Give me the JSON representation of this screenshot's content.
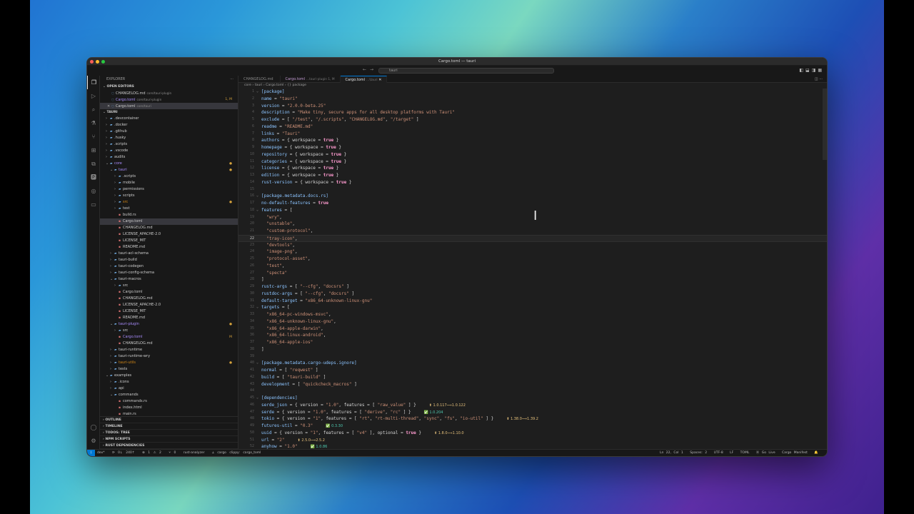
{
  "window": {
    "title": "Cargo.toml — tauri"
  },
  "command_center": {
    "text": "tauri"
  },
  "colors": {
    "accent": "#0078d4",
    "modified": "#e2c08d"
  },
  "activity_bar": [
    "files-icon",
    "run-debug-icon",
    "search-icon",
    "testing-icon",
    "source-control-icon",
    "extensions-icon",
    "remote-explorer-icon",
    "docker-icon",
    "github-icon",
    "chat-icon"
  ],
  "sidebar": {
    "title": "EXPLORER",
    "open_editors_label": "OPEN EDITORS",
    "open_editors": [
      {
        "prefix": "",
        "name": "CHANGELOG.md",
        "path": "core/tauri-plugin",
        "badge": ""
      },
      {
        "prefix": "",
        "name": "Cargo.toml",
        "path": "core/tauri-plugin",
        "badge": "1, M"
      },
      {
        "prefix": "✕",
        "name": "Cargo.toml",
        "path": "core/tauri",
        "badge": ""
      }
    ],
    "project_label": "TAURI",
    "tree": [
      {
        "name": ".devcontainer",
        "depth": 1,
        "kind": "folder",
        "state": "",
        "badge": ""
      },
      {
        "name": ".docker",
        "depth": 1,
        "kind": "folder",
        "state": "",
        "badge": ""
      },
      {
        "name": ".github",
        "depth": 1,
        "kind": "folder",
        "state": "",
        "badge": ""
      },
      {
        "name": ".husky",
        "depth": 1,
        "kind": "folder",
        "state": "",
        "badge": ""
      },
      {
        "name": ".scripts",
        "depth": 1,
        "kind": "folder",
        "state": "",
        "badge": ""
      },
      {
        "name": ".vscode",
        "depth": 1,
        "kind": "folder",
        "state": "",
        "badge": ""
      },
      {
        "name": "audits",
        "depth": 1,
        "kind": "folder",
        "state": "",
        "badge": ""
      },
      {
        "name": "core",
        "depth": 1,
        "kind": "folder-open",
        "state": "pur",
        "badge": "●"
      },
      {
        "name": "tauri",
        "depth": 2,
        "kind": "folder-open",
        "state": "pur",
        "badge": "●"
      },
      {
        "name": ".scripts",
        "depth": 3,
        "kind": "folder",
        "state": "",
        "badge": ""
      },
      {
        "name": "mobile",
        "depth": 3,
        "kind": "folder",
        "state": "",
        "badge": ""
      },
      {
        "name": "permissions",
        "depth": 3,
        "kind": "folder",
        "state": "",
        "badge": ""
      },
      {
        "name": "scripts",
        "depth": 3,
        "kind": "folder",
        "state": "",
        "badge": ""
      },
      {
        "name": "src",
        "depth": 3,
        "kind": "folder",
        "state": "orange",
        "badge": "●"
      },
      {
        "name": "test",
        "depth": 3,
        "kind": "folder",
        "state": "",
        "badge": ""
      },
      {
        "name": "build.rs",
        "depth": 3,
        "kind": "file",
        "state": "",
        "badge": ""
      },
      {
        "name": "Cargo.toml",
        "depth": 3,
        "kind": "file",
        "state": "sel",
        "badge": ""
      },
      {
        "name": "CHANGELOG.md",
        "depth": 3,
        "kind": "file",
        "state": "",
        "badge": ""
      },
      {
        "name": "LICENSE_APACHE-2.0",
        "depth": 3,
        "kind": "file",
        "state": "",
        "badge": ""
      },
      {
        "name": "LICENSE_MIT",
        "depth": 3,
        "kind": "file",
        "state": "",
        "badge": ""
      },
      {
        "name": "README.md",
        "depth": 3,
        "kind": "file",
        "state": "",
        "badge": ""
      },
      {
        "name": "tauri-acl-schema",
        "depth": 2,
        "kind": "folder",
        "state": "",
        "badge": ""
      },
      {
        "name": "tauri-build",
        "depth": 2,
        "kind": "folder",
        "state": "",
        "badge": ""
      },
      {
        "name": "tauri-codegen",
        "depth": 2,
        "kind": "folder",
        "state": "",
        "badge": ""
      },
      {
        "name": "tauri-config-schema",
        "depth": 2,
        "kind": "folder",
        "state": "",
        "badge": ""
      },
      {
        "name": "tauri-macros",
        "depth": 2,
        "kind": "folder-open",
        "state": "",
        "badge": ""
      },
      {
        "name": "src",
        "depth": 3,
        "kind": "folder",
        "state": "",
        "badge": ""
      },
      {
        "name": "Cargo.toml",
        "depth": 3,
        "kind": "file",
        "state": "",
        "badge": ""
      },
      {
        "name": "CHANGELOG.md",
        "depth": 3,
        "kind": "file",
        "state": "",
        "badge": ""
      },
      {
        "name": "LICENSE_APACHE-2.0",
        "depth": 3,
        "kind": "file",
        "state": "",
        "badge": ""
      },
      {
        "name": "LICENSE_MIT",
        "depth": 3,
        "kind": "file",
        "state": "",
        "badge": ""
      },
      {
        "name": "README.md",
        "depth": 3,
        "kind": "file",
        "state": "",
        "badge": ""
      },
      {
        "name": "tauri-plugin",
        "depth": 2,
        "kind": "folder-open",
        "state": "pur",
        "badge": "●"
      },
      {
        "name": "src",
        "depth": 3,
        "kind": "folder",
        "state": "",
        "badge": ""
      },
      {
        "name": "Cargo.toml",
        "depth": 3,
        "kind": "file",
        "state": "pur",
        "badge": "M"
      },
      {
        "name": "CHANGELOG.md",
        "depth": 3,
        "kind": "file",
        "state": "",
        "badge": ""
      },
      {
        "name": "tauri-runtime",
        "depth": 2,
        "kind": "folder",
        "state": "",
        "badge": ""
      },
      {
        "name": "tauri-runtime-wry",
        "depth": 2,
        "kind": "folder",
        "state": "",
        "badge": ""
      },
      {
        "name": "tauri-utils",
        "depth": 2,
        "kind": "folder",
        "state": "orange",
        "badge": "●"
      },
      {
        "name": "tests",
        "depth": 2,
        "kind": "folder",
        "state": "",
        "badge": ""
      },
      {
        "name": "examples",
        "depth": 1,
        "kind": "folder-open",
        "state": "",
        "badge": ""
      },
      {
        "name": ".icons",
        "depth": 2,
        "kind": "folder",
        "state": "",
        "badge": ""
      },
      {
        "name": "api",
        "depth": 2,
        "kind": "folder",
        "state": "",
        "badge": ""
      },
      {
        "name": "commands",
        "depth": 2,
        "kind": "folder-open",
        "state": "",
        "badge": ""
      },
      {
        "name": "commands.rs",
        "depth": 3,
        "kind": "file",
        "state": "",
        "badge": ""
      },
      {
        "name": "index.html",
        "depth": 3,
        "kind": "file",
        "state": "",
        "badge": ""
      },
      {
        "name": "main.rs",
        "depth": 3,
        "kind": "file",
        "state": "",
        "badge": ""
      }
    ],
    "bottom_sections": [
      "OUTLINE",
      "TIMELINE",
      "TODOS: TREE",
      "NPM SCRIPTS",
      "RUST DEPENDENCIES"
    ]
  },
  "tabs": [
    {
      "label": "CHANGELOG.md",
      "sub": "",
      "active": false,
      "modified": false
    },
    {
      "label": "Cargo.toml",
      "sub": "...tauri-plugin 1, M",
      "active": false,
      "modified": true
    },
    {
      "label": "Cargo.toml",
      "sub": "...\\tauri",
      "active": true,
      "modified": false
    }
  ],
  "breadcrumb": "core › tauri › Cargo.toml › {} package",
  "code": [
    {
      "n": "1",
      "f": "⌄",
      "t": "[package]"
    },
    {
      "n": "2",
      "f": "",
      "t": "name = \"tauri\""
    },
    {
      "n": "3",
      "f": "",
      "t": "version = \"2.0.0-beta.25\""
    },
    {
      "n": "4",
      "f": "",
      "t": "description = \"Make tiny, secure apps for all desktop platforms with Tauri\""
    },
    {
      "n": "5",
      "f": "",
      "t": "exclude = [ \"/test\", \"/.scripts\", \"CHANGELOG.md\", \"/target\" ]"
    },
    {
      "n": "6",
      "f": "",
      "t": "readme = \"README.md\""
    },
    {
      "n": "7",
      "f": "",
      "t": "links = \"Tauri\""
    },
    {
      "n": "8",
      "f": "",
      "t": "authors = { workspace = true }"
    },
    {
      "n": "9",
      "f": "",
      "t": "homepage = { workspace = true }"
    },
    {
      "n": "10",
      "f": "",
      "t": "repository = { workspace = true }"
    },
    {
      "n": "11",
      "f": "",
      "t": "categories = { workspace = true }"
    },
    {
      "n": "12",
      "f": "",
      "t": "license = { workspace = true }"
    },
    {
      "n": "13",
      "f": "",
      "t": "edition = { workspace = true }"
    },
    {
      "n": "14",
      "f": "",
      "t": "rust-version = { workspace = true }"
    },
    {
      "n": "15",
      "f": "",
      "t": ""
    },
    {
      "n": "16",
      "f": "⌄",
      "t": "[package.metadata.docs.rs]"
    },
    {
      "n": "17",
      "f": "",
      "t": "no-default-features = true"
    },
    {
      "n": "18",
      "f": "⌄",
      "t": "features = ["
    },
    {
      "n": "19",
      "f": "",
      "t": "  \"wry\","
    },
    {
      "n": "20",
      "f": "",
      "t": "  \"unstable\","
    },
    {
      "n": "21",
      "f": "",
      "t": "  \"custom-protocol\","
    },
    {
      "n": "22",
      "f": "",
      "t": "  \"tray-icon\",",
      "cur": true
    },
    {
      "n": "23",
      "f": "",
      "t": "  \"devtools\","
    },
    {
      "n": "24",
      "f": "",
      "t": "  \"image-png\","
    },
    {
      "n": "25",
      "f": "",
      "t": "  \"protocol-asset\","
    },
    {
      "n": "26",
      "f": "",
      "t": "  \"test\","
    },
    {
      "n": "27",
      "f": "",
      "t": "  \"specta\""
    },
    {
      "n": "28",
      "f": "",
      "t": "]"
    },
    {
      "n": "29",
      "f": "",
      "t": "rustc-args = [ \"--cfg\", \"docsrs\" ]"
    },
    {
      "n": "30",
      "f": "",
      "t": "rustdoc-args = [ \"--cfg\", \"docsrs\" ]"
    },
    {
      "n": "31",
      "f": "",
      "t": "default-target = \"x86_64-unknown-linux-gnu\""
    },
    {
      "n": "32",
      "f": "⌄",
      "t": "targets = ["
    },
    {
      "n": "33",
      "f": "",
      "t": "  \"x86_64-pc-windows-msvc\","
    },
    {
      "n": "34",
      "f": "",
      "t": "  \"x86_64-unknown-linux-gnu\","
    },
    {
      "n": "35",
      "f": "",
      "t": "  \"x86_64-apple-darwin\","
    },
    {
      "n": "36",
      "f": "",
      "t": "  \"x86_64-linux-android\","
    },
    {
      "n": "37",
      "f": "",
      "t": "  \"x86_64-apple-ios\""
    },
    {
      "n": "38",
      "f": "",
      "t": "]"
    },
    {
      "n": "39",
      "f": "",
      "t": ""
    },
    {
      "n": "40",
      "f": "⌄",
      "t": "[package.metadata.cargo-udeps.ignore]"
    },
    {
      "n": "41",
      "f": "",
      "t": "normal = [ \"reqwest\" ]"
    },
    {
      "n": "42",
      "f": "",
      "t": "build = [ \"tauri-build\" ]"
    },
    {
      "n": "43",
      "f": "",
      "t": "development = [ \"quickcheck_macros\" ]"
    },
    {
      "n": "44",
      "f": "",
      "t": ""
    },
    {
      "n": "45",
      "f": "⌄",
      "t": "[dependencies]"
    },
    {
      "n": "46",
      "f": "",
      "t": "serde_json = { version = \"1.0\", features = [ \"raw_value\" ] }",
      "hint": "1.0.117⟹1.0.122",
      "hk": "up"
    },
    {
      "n": "47",
      "f": "",
      "t": "serde = { version = \"1.0\", features = [ \"derive\", \"rc\" ] }",
      "hint": "1.0.204",
      "hk": "ok"
    },
    {
      "n": "48",
      "f": "",
      "t": "tokio = { version = \"1\", features = [ \"rt\", \"rt-multi-thread\", \"sync\", \"fs\", \"io-util\" ] }",
      "hint": "1.38.0⟹1.39.2",
      "hk": "up"
    },
    {
      "n": "49",
      "f": "",
      "t": "futures-util = \"0.3\"",
      "hint": "0.3.30",
      "hk": "ok"
    },
    {
      "n": "50",
      "f": "",
      "t": "uuid = { version = \"1\", features = [ \"v4\" ], optional = true }",
      "hint": "1.8.0⟹1.10.0",
      "hk": "up"
    },
    {
      "n": "51",
      "f": "",
      "t": "url = \"2\"",
      "hint": "2.5.0⟹2.5.2",
      "hk": "up"
    },
    {
      "n": "52",
      "f": "",
      "t": "anyhow = \"1.0\"",
      "hint": "1.0.86",
      "hk": "ok"
    }
  ],
  "status": {
    "branch": "dev*",
    "sync": "⟳ 0↓ 240↑",
    "problems": "⊗ 1 ⚠ 2",
    "ports": "⑂ 0",
    "analyzer": "rust-analyzer",
    "task": "⟂ cargo clippy: cargo_toml",
    "position": "Ln 22, Col 1",
    "spaces": "Spaces: 2",
    "encoding": "UTF-8",
    "eol": "LF",
    "language": "TOML",
    "golive": "⦿ Go Live",
    "manifest": "Cargo Manifest",
    "bell": "🔔"
  }
}
